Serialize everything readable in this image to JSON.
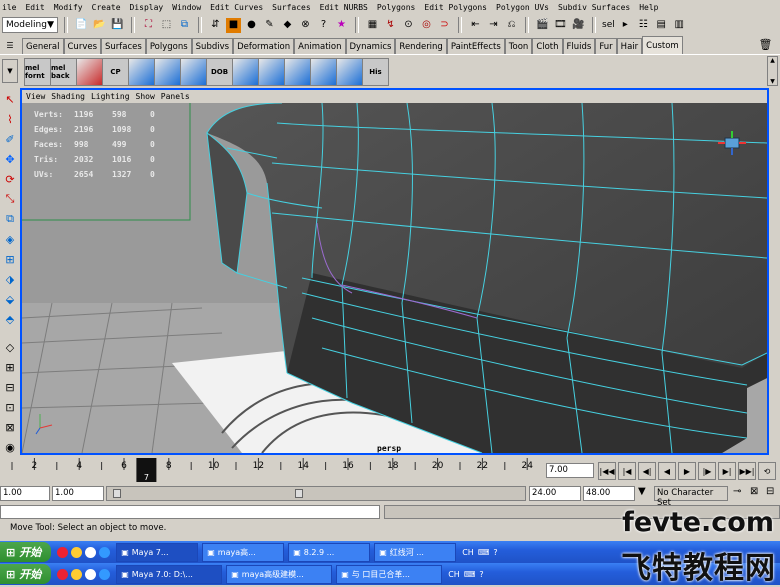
{
  "menubar": {
    "items": [
      "ile",
      "Edit",
      "Modify",
      "Create",
      "Display",
      "Window",
      "Edit Curves",
      "Surfaces",
      "Edit NURBS",
      "Polygons",
      "Edit Polygons",
      "Polygon UVs",
      "Subdiv Surfaces",
      "Help"
    ]
  },
  "statusline": {
    "mode": "Modeling",
    "sel_label": "sel"
  },
  "shelf": {
    "tabs": [
      "General",
      "Curves",
      "Surfaces",
      "Polygons",
      "Subdivs",
      "Deformation",
      "Animation",
      "Dynamics",
      "Rendering",
      "PaintEffects",
      "Toon",
      "Cloth",
      "Fluids",
      "Fur",
      "Hair",
      "Custom"
    ],
    "active_tab": "Custom",
    "buttons": [
      "mel fornt",
      "mel back",
      "",
      "CP",
      "",
      "",
      "",
      "DOB",
      "",
      "",
      "",
      "",
      "",
      "His"
    ]
  },
  "viewport": {
    "panel_menu": [
      "View",
      "Shading",
      "Lighting",
      "Show",
      "Panels"
    ],
    "camera": "persp",
    "hud": [
      {
        "label": "Verts:",
        "v1": "1196",
        "v2": "598",
        "v3": "0"
      },
      {
        "label": "Edges:",
        "v1": "2196",
        "v2": "1098",
        "v3": "0"
      },
      {
        "label": "Faces:",
        "v1": "998",
        "v2": "499",
        "v3": "0"
      },
      {
        "label": "Tris:",
        "v1": "2032",
        "v2": "1016",
        "v3": "0"
      },
      {
        "label": "UVs:",
        "v1": "2654",
        "v2": "1327",
        "v3": "0"
      }
    ]
  },
  "timeline": {
    "ticks": [
      "2",
      "4",
      "6",
      "8",
      "10",
      "12",
      "14",
      "16",
      "18",
      "20",
      "22",
      "24"
    ],
    "current_frame": "7",
    "current_time": "7.00"
  },
  "range": {
    "start_time": "1.00",
    "playback_start": "1.00",
    "playback_end": "24.00",
    "end_time": "48.00",
    "character_set": "No Character Set"
  },
  "help_line": "Move Tool: Select an object to move.",
  "taskbars": [
    {
      "start": "开始",
      "tasks": [
        "Maya 7...",
        "maya高...",
        "8.2.9 ...",
        "红线河 ..."
      ],
      "tray": "CH"
    },
    {
      "start": "开始",
      "tasks": [
        "Maya 7.0: D:\\...",
        "maya高级建模...",
        "与 口目己合革..."
      ],
      "tray": "CH"
    }
  ],
  "watermark": {
    "line1": "fevte.com",
    "line2": "飞特教程网"
  }
}
